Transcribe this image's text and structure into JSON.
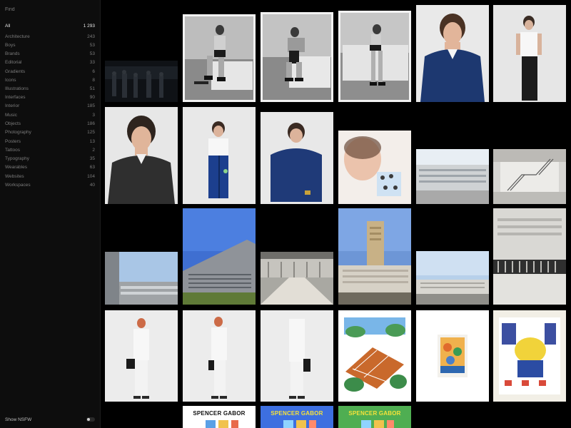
{
  "sidebar": {
    "search_placeholder": "Find",
    "categories": [
      {
        "label": "All",
        "count": "1 293",
        "active": true
      },
      {
        "label": "Architecture",
        "count": "243"
      },
      {
        "label": "Boys",
        "count": "53"
      },
      {
        "label": "Brands",
        "count": "53"
      },
      {
        "label": "Editorial",
        "count": "33"
      },
      {
        "label": "Gradients",
        "count": "6"
      },
      {
        "label": "Icons",
        "count": "8"
      },
      {
        "label": "Illustrations",
        "count": "51"
      },
      {
        "label": "Interfaces",
        "count": "90"
      },
      {
        "label": "Interior",
        "count": "185"
      },
      {
        "label": "Music",
        "count": "3"
      },
      {
        "label": "Objects",
        "count": "186"
      },
      {
        "label": "Photography",
        "count": "125"
      },
      {
        "label": "Posters",
        "count": "13"
      },
      {
        "label": "Tattoos",
        "count": "2"
      },
      {
        "label": "Typography",
        "count": "35"
      },
      {
        "label": "Wearables",
        "count": "63"
      },
      {
        "label": "Websites",
        "count": "104"
      },
      {
        "label": "Workspaces",
        "count": "40"
      }
    ],
    "nsfw_label": "Show NSFW",
    "nsfw_enabled": false
  },
  "gallery": {
    "cards": [
      {
        "title": "SPENCER GABOR",
        "bg": "#ffffff",
        "fg": "#111111"
      },
      {
        "title": "SPENCER GABOR",
        "bg": "#3d6fe0",
        "fg": "#f5e23a"
      },
      {
        "title": "SPENCER GABOR",
        "bg": "#4fae52",
        "fg": "#f5e23a"
      }
    ]
  },
  "colors": {
    "background": "#000000",
    "sidebar_bg": "#0d0d0d",
    "text_muted": "#7b7b7b",
    "text_active": "#e6e6e6"
  }
}
